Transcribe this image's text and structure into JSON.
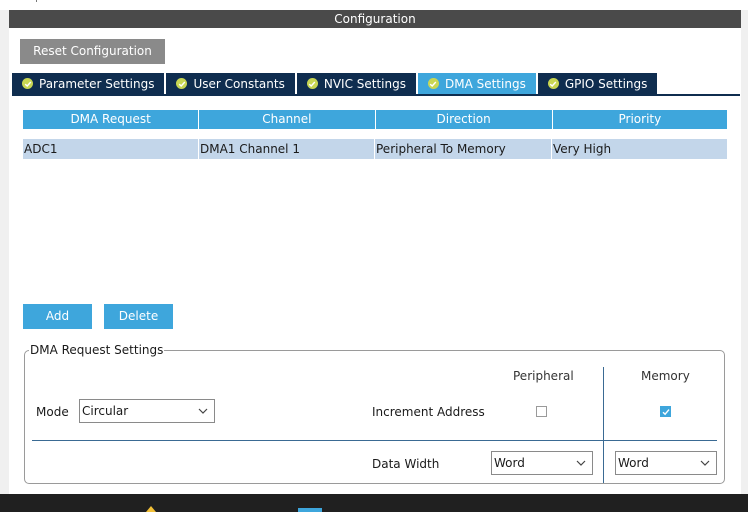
{
  "header": {
    "title": "Configuration"
  },
  "toolbar": {
    "reset_label": "Reset Configuration"
  },
  "tabs": [
    {
      "label": "Parameter Settings",
      "active": false
    },
    {
      "label": "User Constants",
      "active": false
    },
    {
      "label": "NVIC Settings",
      "active": false
    },
    {
      "label": "DMA Settings",
      "active": true
    },
    {
      "label": "GPIO Settings",
      "active": false
    }
  ],
  "table": {
    "columns": [
      "DMA Request",
      "Channel",
      "Direction",
      "Priority"
    ],
    "rows": [
      [
        "ADC1",
        "DMA1 Channel 1",
        "Peripheral To Memory",
        "Very High"
      ]
    ]
  },
  "actions": {
    "add_label": "Add",
    "delete_label": "Delete"
  },
  "settings": {
    "legend": "DMA Request Settings",
    "peripheral_header": "Peripheral",
    "memory_header": "Memory",
    "mode_label": "Mode",
    "mode_value": "Circular",
    "increment_label": "Increment Address",
    "increment_peripheral": false,
    "increment_memory": true,
    "data_width_label": "Data Width",
    "data_width_peripheral": "Word",
    "data_width_memory": "Word"
  },
  "colors": {
    "accent": "#3ea6dc",
    "tab_dark": "#0f2d4f",
    "header": "#4a4a4a",
    "row_selected": "#c3d6ea"
  },
  "icons": {
    "tab_status": "check-circle-icon",
    "dropdown": "chevron-down-icon",
    "checkbox": "checkmark-icon"
  }
}
